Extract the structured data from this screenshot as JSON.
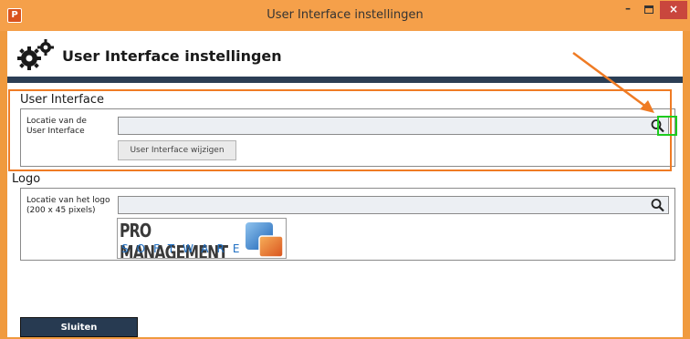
{
  "window": {
    "title": "User Interface instellingen",
    "app_icon_glyph": "P",
    "minimize_glyph": "–",
    "close_glyph": "×"
  },
  "header": {
    "title": "User Interface instellingen",
    "icon": "gears-icon"
  },
  "ui_group": {
    "title": "User Interface",
    "field_label": "Locatie van de\nUser Interface",
    "field_value": "",
    "button_label": "User Interface wijzigen"
  },
  "logo_group": {
    "title": "Logo",
    "field_label": "Locatie van het logo\n(200 x 45 pixels)",
    "field_value": "",
    "logo_line1": "PRO MANAGEMENT",
    "logo_line2": "SOFTWARE"
  },
  "footer": {
    "close_label": "Sluiten"
  },
  "colors": {
    "accent_orange": "#ef7b24",
    "highlight_green": "#1ecc1e",
    "header_rule": "#2b3e55",
    "close_button": "#273a51"
  }
}
